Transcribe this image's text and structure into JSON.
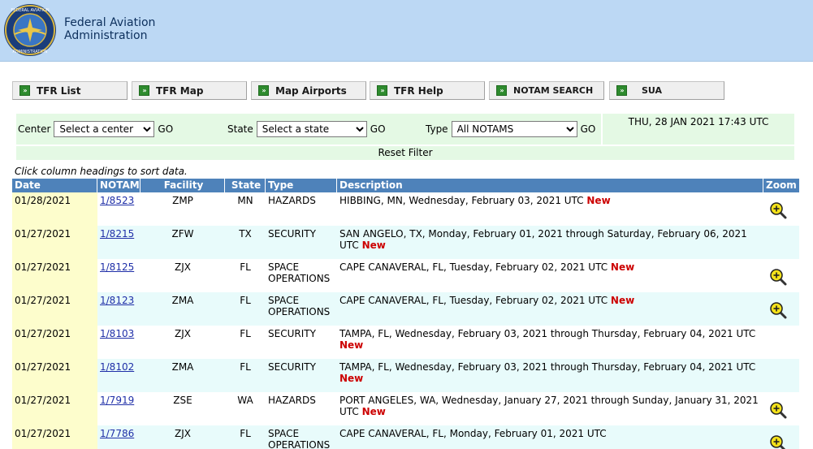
{
  "header": {
    "agency_line1": "Federal Aviation",
    "agency_line2": "Administration"
  },
  "tabs": [
    {
      "label": "TFR List"
    },
    {
      "label": "TFR Map"
    },
    {
      "label": "Map Airports"
    },
    {
      "label": "TFR Help"
    },
    {
      "label": "NOTAM SEARCH"
    },
    {
      "label": "SUA"
    }
  ],
  "filters": {
    "center_label": "Center",
    "center_value": "Select a center",
    "state_label": "State",
    "state_value": "Select a state",
    "type_label": "Type",
    "type_value": "All NOTAMS",
    "go_label": "GO",
    "datetime": "THU, 28 JAN 2021 17:43 UTC",
    "reset_label": "Reset Filter"
  },
  "hint": "Click column headings to sort data.",
  "table": {
    "columns": [
      "Date",
      "NOTAM",
      "Facility",
      "State",
      "Type",
      "Description",
      "Zoom"
    ],
    "new_label": "New",
    "rows": [
      {
        "date": "01/28/2021",
        "notam": "1/8523",
        "facility": "ZMP",
        "state": "MN",
        "type": "HAZARDS",
        "description": "HIBBING, MN, Wednesday, February 03, 2021 UTC",
        "is_new": true,
        "zoom": true
      },
      {
        "date": "01/27/2021",
        "notam": "1/8215",
        "facility": "ZFW",
        "state": "TX",
        "type": "SECURITY",
        "description": "SAN ANGELO, TX, Monday, February 01, 2021 through Saturday, February 06, 2021 UTC",
        "is_new": true,
        "zoom": false
      },
      {
        "date": "01/27/2021",
        "notam": "1/8125",
        "facility": "ZJX",
        "state": "FL",
        "type": "SPACE OPERATIONS",
        "description": "CAPE CANAVERAL, FL, Tuesday, February 02, 2021 UTC",
        "is_new": true,
        "zoom": true
      },
      {
        "date": "01/27/2021",
        "notam": "1/8123",
        "facility": "ZMA",
        "state": "FL",
        "type": "SPACE OPERATIONS",
        "description": "CAPE CANAVERAL, FL, Tuesday, February 02, 2021 UTC",
        "is_new": true,
        "zoom": true
      },
      {
        "date": "01/27/2021",
        "notam": "1/8103",
        "facility": "ZJX",
        "state": "FL",
        "type": "SECURITY",
        "description": "TAMPA, FL, Wednesday, February 03, 2021 through Thursday, February 04, 2021 UTC",
        "is_new": true,
        "zoom": false
      },
      {
        "date": "01/27/2021",
        "notam": "1/8102",
        "facility": "ZMA",
        "state": "FL",
        "type": "SECURITY",
        "description": "TAMPA, FL, Wednesday, February 03, 2021 through Thursday, February 04, 2021 UTC",
        "is_new": true,
        "zoom": false
      },
      {
        "date": "01/27/2021",
        "notam": "1/7919",
        "facility": "ZSE",
        "state": "WA",
        "type": "HAZARDS",
        "description": "PORT ANGELES, WA, Wednesday, January 27, 2021 through Sunday, January 31, 2021 UTC",
        "is_new": true,
        "zoom": true
      },
      {
        "date": "01/27/2021",
        "notam": "1/7786",
        "facility": "ZJX",
        "state": "FL",
        "type": "SPACE OPERATIONS",
        "description": "CAPE CANAVERAL, FL, Monday, February 01, 2021 UTC",
        "is_new": false,
        "zoom": true
      }
    ]
  },
  "colors": {
    "header_bg": "#bcd8f4",
    "table_header_bg": "#4e82ba",
    "filter_bg": "#e4f9e4",
    "date_col_bg": "#fdfdcc",
    "alt_row_bg": "#e8fbfb",
    "new_red": "#cc0000",
    "link_blue": "#1f2fa8"
  },
  "icons": {
    "seal": "faa-seal-icon",
    "tab_arrow": "double-arrow-icon",
    "zoom": "magnifier-plus-icon"
  }
}
